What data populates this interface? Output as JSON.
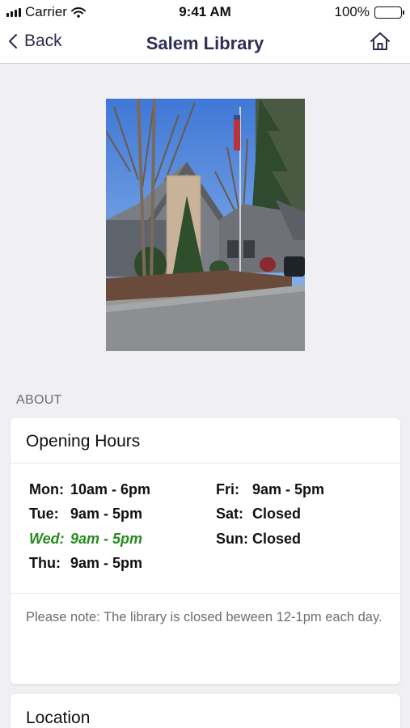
{
  "status_bar": {
    "carrier": "Carrier",
    "time": "9:41 AM",
    "battery": "100%"
  },
  "nav": {
    "back_label": "Back",
    "title": "Salem Library"
  },
  "about": {
    "header": "ABOUT",
    "opening_hours_title": "Opening Hours",
    "hours": [
      {
        "day": "Mon:",
        "time": "10am - 6pm",
        "today": false
      },
      {
        "day": "Tue:",
        "time": "9am - 5pm",
        "today": false
      },
      {
        "day": "Wed:",
        "time": "9am - 5pm",
        "today": true
      },
      {
        "day": "Thu:",
        "time": "9am - 5pm",
        "today": false
      },
      {
        "day": "Fri:",
        "time": "9am - 5pm",
        "today": false
      },
      {
        "day": "Sat:",
        "time": "Closed",
        "today": false
      },
      {
        "day": "Sun:",
        "time": "Closed",
        "today": false
      }
    ],
    "note": "Please note: The library is closed beween 12-1pm each day.",
    "location_title": "Location"
  },
  "colors": {
    "today": "#2a8a1f",
    "nav_title": "#2f2f55",
    "background": "#efeff4"
  }
}
